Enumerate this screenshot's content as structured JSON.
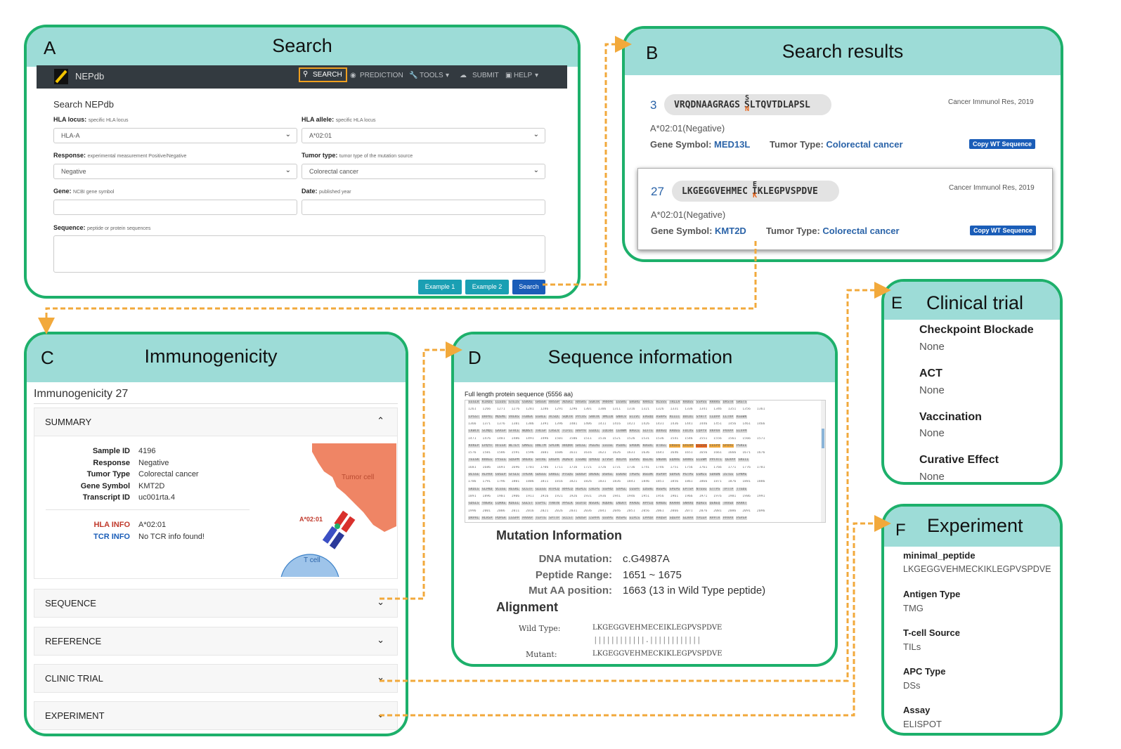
{
  "A": {
    "letter": "A",
    "title": "Search",
    "nav": {
      "brand": "NEPdb",
      "search": "SEARCH",
      "prediction": "PREDICTION",
      "tools": "TOOLS",
      "submit": "SUBMIT",
      "help": "HELP"
    },
    "heading": "Search NEPdb",
    "hla_locus": {
      "label": "HLA locus:",
      "hint": "specific HLA locus",
      "value": "HLA-A"
    },
    "hla_allele": {
      "label": "HLA allele:",
      "hint": "specific HLA locus",
      "value": "A*02:01"
    },
    "response": {
      "label": "Response:",
      "hint": "experimental measurement Positive/Negative",
      "value": "Negative"
    },
    "tumor_type": {
      "label": "Tumor type:",
      "hint": "tumor type of the mutation source",
      "value": "Colorectal cancer"
    },
    "gene": {
      "label": "Gene:",
      "hint": "NCBI gene symbol",
      "value": ""
    },
    "date": {
      "label": "Date:",
      "hint": "published year",
      "value": ""
    },
    "sequence": {
      "label": "Sequence:",
      "hint": "peptide or protein sequences",
      "value": ""
    },
    "buttons": {
      "example1": "Example 1",
      "example2": "Example 2",
      "search": "Search"
    }
  },
  "B": {
    "letter": "B",
    "title": "Search results",
    "results": [
      {
        "num": "3",
        "seq_before": "VRQDNAAGRAGS",
        "wt": "S",
        "mut": "N",
        "seq_after": "SLTQVTDLAPSL",
        "source": "Cancer Immunol Res, 2019",
        "hla": "A*02:01(Negative)",
        "gene_label": "Gene Symbol:",
        "gene": "MED13L",
        "tumor_label": "Tumor Type:",
        "tumor": "Colorectal cancer",
        "copy": "Copy WT Sequence"
      },
      {
        "num": "27",
        "seq_before": "LKGEGGVEHMEC",
        "wt": "E",
        "mut": "K",
        "seq_after": "IKLEGPVSPDVE",
        "source": "Cancer Immunol Res, 2019",
        "hla": "A*02:01(Negative)",
        "gene_label": "Gene Symbol:",
        "gene": "KMT2D",
        "tumor_label": "Tumor Type:",
        "tumor": "Colorectal cancer",
        "copy": "Copy WT Sequence"
      }
    ]
  },
  "C": {
    "letter": "C",
    "title": "Immunogenicity",
    "heading": "Immunogenicity 27",
    "sections": {
      "summary": "SUMMARY",
      "sequence": "SEQUENCE",
      "reference": "REFERENCE",
      "clinic": "CLINIC TRIAL",
      "experiment": "EXPERIMENT"
    },
    "summary": {
      "sample_id_k": "Sample ID",
      "sample_id": "4196",
      "response_k": "Response",
      "response": "Negative",
      "tumor_k": "Tumor Type",
      "tumor": "Colorectal cancer",
      "gene_k": "Gene Symbol",
      "gene": "KMT2D",
      "transcript_k": "Transcript ID",
      "transcript": "uc001rta.4",
      "hla_k": "HLA INFO",
      "hla": "A*02:01",
      "tcr_k": "TCR INFO",
      "tcr": "No TCR info found!"
    },
    "diagram": {
      "tumor": "Tumor cell",
      "tcell": "T cell",
      "allele": "A*02:01"
    }
  },
  "D": {
    "letter": "D",
    "title": "Sequence information",
    "seq_title": "Full length protein sequence (5556 aa)",
    "seq_rows": [
      "EEGLR KIRDS LLEDS GTEIS GSKAE GRGGA RRSSP ADSRI RASRS SGKTR PRRPR LGSRG GRGRG RARLS RLSSS TRLIA RADGS SSPSS RRRRS DRSTR GRGTS",
      "1261 1266 1271 1276 1281 1286 1291 1296 1301 1306 1311 1316 1321 1326 1331 1336 1341 1346 1351 1356 1361",
      "LPSST DRPVL MQSMC VVEKS FGNGA EGHLE ACSQC SQKTR PYCVS SKKTK VMLLN GNRCV ECIVC EVGQQ ASRPS RLLLC DDCDI SYHTY CLDPP LLTVP KGGWK",
      "1366 1371 1376 1381 1386 1391 1396 1401 1406 1411 1416 1421 1426 1431 1436 1441 1446 1451 1456 1461 1466",
      "CKWCV SCMQC GAASP GFHCE WQNSY THCGP CASLV TCPIC HAPYV EEDLL IQCRH CERWM HAGCE SLFTE DDVEQ AADEG FDCVS CQPYV VKPVA PVAPP ELVPM",
      "1471 1476 1481 1486 1491 1496 1501 1506 1511 1516 1521 1526 1531 1536 1541 1546 1551 1556 1561 1566 1571",
      "KVKEP EPQYF RFEGV WLTEY GMALL RNLTM SPLHK RRQRR GRLGL PGEAG LEGSE PSDAL GPDDK KDGDL DTDEL LKGEG GVEHM ECEIK LEGPV SPDVE PGKEE",
      "1576 1581 1586 1591 1596 1601 1606 1611 1616 1621 1626 1631 1636 1641 1646 1651 1656 1661 1666 1671 1676",
      "TEESK KKKEE PYSEG SQGPM VREKS SHTRE EKGPA AQAEV LSGNQ QPDEQ ETVSP ADLPA EGAVE QGLAE GNEKK EQARE GRRKS ELEWM PPFATL QEAPP GKELL",
      "1681 1686 1691 1696 1701 1706 1711 1716 1721 1726 1731 1736 1741 1746 1751 1756 1761 1766 1771 1776 1781",
      "DLSSE ALPAV GVGEP GFGLG TPEAK GDGGS EKKEL PTGQG GDDGP DKADE DSRGL EGKAD TPGPE DGGVK ASPVP SDPEK PGTPG EGMLS SDRDN ISTEE LPKME",
      "1786 1791 1796 1801 1806 1811 1816 1821 1826 1831 1836 1841 1846 1851 1856 1861 1866 1871 1876 1881 1886",
      "GKDLG GLPKD VLGSE REGRL GCGTF GLEGS RTPLQ RPPLQ RGPLG CHLPS SSPRD SVPGL CGSPF LDSHE RGGPE SPEPG EPTSP NTGSG GTTPS TPTTP TTGDE",
      "1891 1896 1901 1906 1911 1916 1921 1926 1931 1936 1941 1946 1951 1956 1961 1966 1971 1976 1981 1986 1991",
      "GDGLS YNGRS LQRKE KDEEL GGLST ESPYL YANTN PPSLK GGVTD WSGHC KQDHE LNEKY PAADE APYLQ KAKDE RAAHR SNRVQ RQAES QENEQ TRVGD RARKT",
      "1996 2001 2006 2011 2016 2021 2026 2031 2036 2041 2046 2051 2056 2061 2066 2071 2076 2081 2086 2091 2096",
      "DRPAL HLRSP PQPGA LGSPP PAAAP TEPTG SPTTP SCLST SADSP LSPPA GSVPG PDSPG ELPLS LPPQV PAQSP SQEPP GLAPA YPLEP RPPTA PPAPV PSPSP"
    ],
    "mutation_heading": "Mutation Information",
    "dna_k": "DNA mutation:",
    "dna": "c.G4987A",
    "range_k": "Peptide Range:",
    "range": "1651 ~ 1675",
    "pos_k": "Mut AA position:",
    "pos": "1663 (13 in Wild Type peptide)",
    "alignment_heading": "Alignment",
    "wt_label": "Wild Type:",
    "wt_seq": "LKGEGGVEHMECEIKLEGPVSPDVE",
    "match_line": "||||||||||||.||||||||||||",
    "mut_label": "Mutant:",
    "mut_seq": "LKGEGGVEHMECKIKLEGPVSPDVE"
  },
  "E": {
    "letter": "E",
    "title": "Clinical trial",
    "items": [
      {
        "k": "Checkpoint Blockade",
        "v": "None"
      },
      {
        "k": "ACT",
        "v": "None"
      },
      {
        "k": "Vaccination",
        "v": "None"
      },
      {
        "k": "Curative Effect",
        "v": "None"
      }
    ]
  },
  "F": {
    "letter": "F",
    "title": "Experiment",
    "items": [
      {
        "k": "minimal_peptide",
        "v": "LKGEGGVEHMECKIKLEGPVSPDVE"
      },
      {
        "k": "Antigen Type",
        "v": "TMG"
      },
      {
        "k": "T-cell Source",
        "v": "TILs"
      },
      {
        "k": "APC Type",
        "v": "DSs"
      },
      {
        "k": "Assay",
        "v": "ELISPOT"
      }
    ]
  },
  "colors": {
    "panel_border": "#1db06b",
    "panel_header": "#9ddcd7",
    "connector": "#f2a93b",
    "button_teal": "#1a9fb3",
    "button_blue": "#1a5db8",
    "mutation_orange": "#e8641a"
  }
}
